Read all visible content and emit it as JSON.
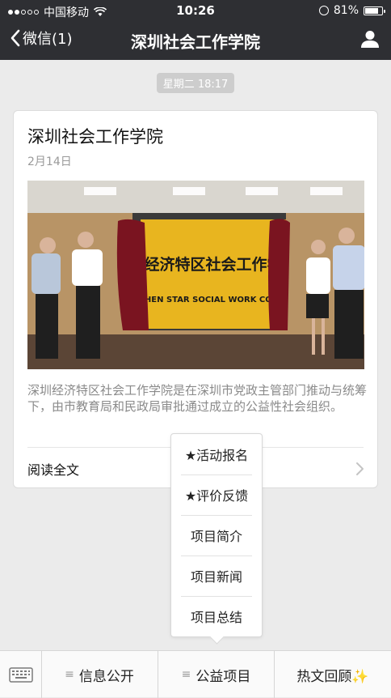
{
  "status_bar": {
    "carrier": "中国移动",
    "time": "10:26",
    "battery": "81%",
    "battery_level": 0.81
  },
  "nav": {
    "back_label": "微信(1)",
    "title": "深圳社会工作学院"
  },
  "timestamp": "星期二 18:17",
  "card": {
    "title": "深圳社会工作学院",
    "date": "2月14日",
    "banner_text_line1": "经济特区社会工作学",
    "banner_text_line2": "ZHEN STAR SOCIAL WORK COLLE",
    "description": "深圳经济特区社会工作学院是在深圳市党政主管部门推动与统筹下，由市教育局和民政局审批通过成立的公益性社会组织。",
    "read_more": "阅读全文"
  },
  "popup_menu": {
    "items": [
      "★活动报名",
      "★评价反馈",
      "项目简介",
      "项目新闻",
      "项目总结"
    ]
  },
  "bottom_menu": {
    "items": [
      "信息公开",
      "公益项目",
      "热文回顾✨"
    ]
  },
  "colors": {
    "nav_bg": "#2e2f33",
    "page_bg": "#ebebeb",
    "banner_yellow": "#e8b51f"
  }
}
